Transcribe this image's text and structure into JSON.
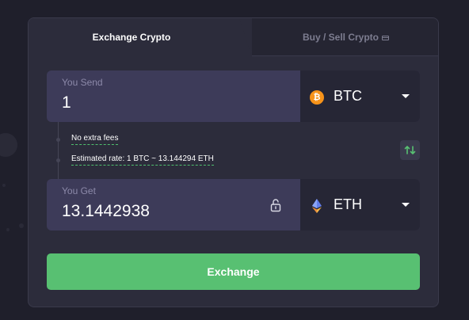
{
  "tabs": {
    "exchange": "Exchange Crypto",
    "buy_sell": "Buy / Sell Crypto",
    "buy_sell_icon": "credit-card-icon"
  },
  "send": {
    "label": "You Send",
    "value": "1",
    "currency": "BTC",
    "currency_icon": "bitcoin-icon",
    "currency_color": "#f7931a"
  },
  "info": {
    "fees": "No extra fees",
    "rate": "Estimated rate: 1 BTC ~ 13.144294 ETH"
  },
  "get": {
    "label": "You Get",
    "value": "13.1442938",
    "currency": "ETH",
    "currency_icon": "ethereum-icon",
    "lock_icon": "unlock-icon"
  },
  "swap_icon": "swap-arrows-icon",
  "exchange_button": "Exchange",
  "colors": {
    "accent": "#58c072",
    "background": "#1f1f2b",
    "card": "#2c2c3b",
    "field": "#3d3b59"
  }
}
